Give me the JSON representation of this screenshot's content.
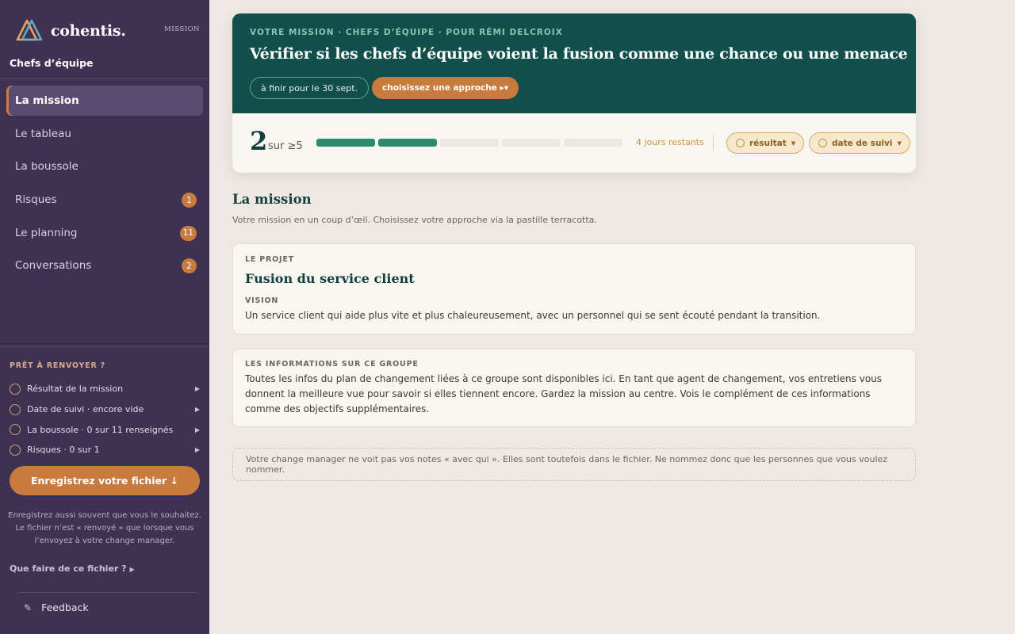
{
  "brand": {
    "name": "cohentis.",
    "tag": "MISSION"
  },
  "sidebar": {
    "group_title": "Chefs d’équipe",
    "nav": [
      {
        "label": "La mission",
        "active": true,
        "badge": ""
      },
      {
        "label": "Le tableau",
        "active": false,
        "badge": ""
      },
      {
        "label": "La boussole",
        "active": false,
        "badge": ""
      },
      {
        "label": "Risques",
        "active": false,
        "badge": "1"
      },
      {
        "label": "Le planning",
        "active": false,
        "badge": "11"
      },
      {
        "label": "Conversations",
        "active": false,
        "badge": "2"
      }
    ],
    "ready_title": "PRÊT À RENVOYER ?",
    "checklist": [
      "Résultat de la mission",
      "Date de suivi · encore vide",
      "La boussole · 0 sur 11 renseignés",
      "Risques · 0 sur 1"
    ],
    "save_label": "Enregistrez votre fichier ↓",
    "save_note": "Enregistrez aussi souvent que vous le souhaitez. Le fichier n’est « renvoyé » que lorsque vous l’envoyez à votre change manager.",
    "help_label": "Que faire de ce fichier ?",
    "feedback_label": "Feedback"
  },
  "hero": {
    "kicker": "VOTRE MISSION · CHEFS D’ÉQUIPE · POUR RÉMI DELCROIX",
    "title": "Vérifier si les chefs d’équipe voient la fusion comme une chance ou une menace",
    "due": "à finir pour le 30 sept.",
    "approach": "choisissez une approche ▸▾",
    "progress_count": "2",
    "progress_of": "sur ≥5",
    "progress_done": 2,
    "progress_total": 5,
    "days_left": "4 jours restants",
    "chip_result": "résultat",
    "chip_followup": "date de suivi"
  },
  "main": {
    "section_title": "La mission",
    "section_sub": "Votre mission en un coup d’œil. Choisissez votre approche via la pastille terracotta.",
    "project_label": "LE PROJET",
    "project_name": "Fusion du service client",
    "vision_label": "VISION",
    "vision_text": "Un service client qui aide plus vite et plus chaleureusement, avec un personnel qui se sent écouté pendant la transition.",
    "info_label": "LES INFORMATIONS SUR CE GROUPE",
    "info_text": "Toutes les infos du plan de changement liées à ce groupe sont disponibles ici. En tant que agent de changement, vos entretiens vous donnent la meilleure vue pour savoir si elles tiennent encore. Gardez la mission au centre. Vois le complément de ces informations comme des objectifs supplémentaires.",
    "note": "Votre change manager ne voit pas vos notes « avec qui ». Elles sont toutefois dans le fichier. Ne nommez donc que les personnes que vous voulez nommer."
  },
  "colors": {
    "sidebar": "#3e3252",
    "hero": "#124f4b",
    "accent": "#c97a3f",
    "progress": "#2c8a6e"
  }
}
